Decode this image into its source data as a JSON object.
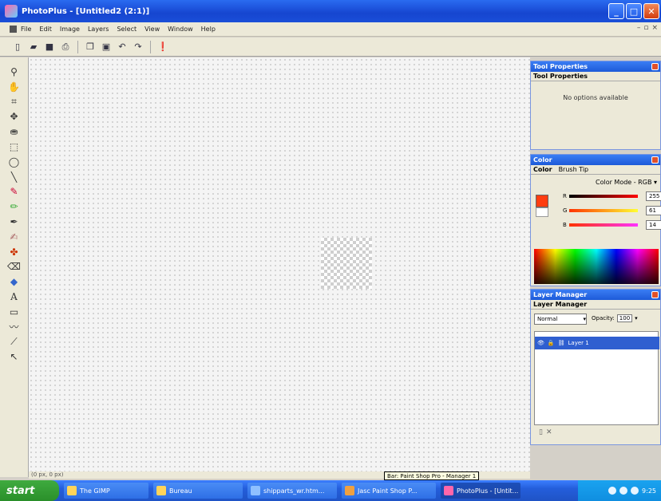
{
  "window": {
    "title": "PhotoPlus - [Untitled2 (2:1)]"
  },
  "menu": {
    "items": [
      "File",
      "Edit",
      "Image",
      "Layers",
      "Select",
      "View",
      "Window",
      "Help"
    ]
  },
  "panels": {
    "tool_properties": {
      "title": "Tool Properties",
      "tab": "Tool Properties",
      "message": "No options available"
    },
    "color": {
      "title": "Color",
      "tabs": [
        "Color",
        "Brush Tip"
      ],
      "mode": "Color Mode - RGB",
      "r": "255",
      "g": "61",
      "b": "14",
      "r_label": "R",
      "g_label": "G",
      "b_label": "B",
      "fg_color": "#ff3d10"
    },
    "layer_manager": {
      "title": "Layer Manager",
      "tab": "Layer Manager",
      "blend_mode": "Normal",
      "opacity_label": "Opacity:",
      "opacity": "100",
      "layer_name": "Layer 1"
    }
  },
  "status": {
    "coords": "(0 px, 0 px)",
    "tooltip": "Bar: Paint Shop Pro - Manager 1"
  },
  "taskbar": {
    "start": "start",
    "tasks": [
      "The GIMP",
      "Bureau",
      "shipparts_wr.htm...",
      "Jasc Paint Shop P...",
      "PhotoPlus - [Untit..."
    ],
    "clock": "9:25"
  }
}
